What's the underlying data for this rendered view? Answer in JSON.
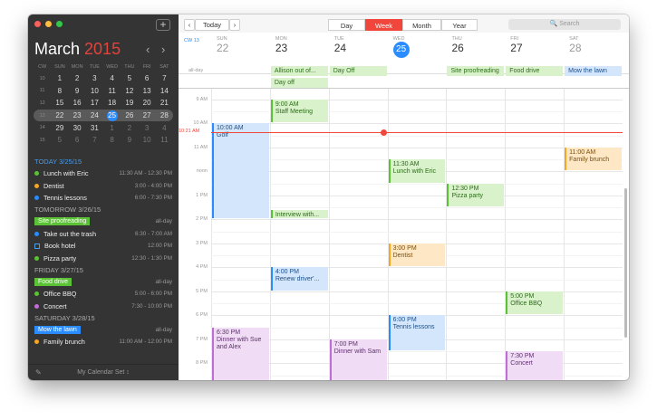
{
  "app": {
    "window": {
      "traffic": [
        "#fc605b",
        "#fdbc40",
        "#34c84a"
      ]
    },
    "add_label": "+"
  },
  "sidebar": {
    "month": "March",
    "year": "2015",
    "prev": "‹",
    "next": "›",
    "weekdays": [
      "CW",
      "SUN",
      "MON",
      "TUE",
      "WED",
      "THU",
      "FRI",
      "SAT"
    ],
    "weeks": [
      [
        "10",
        "1",
        "2",
        "3",
        "4",
        "5",
        "6",
        "7"
      ],
      [
        "11",
        "8",
        "9",
        "10",
        "11",
        "12",
        "13",
        "14"
      ],
      [
        "12",
        "15",
        "16",
        "17",
        "18",
        "19",
        "20",
        "21"
      ],
      [
        "13",
        "22",
        "23",
        "24",
        "25",
        "26",
        "27",
        "28"
      ],
      [
        "14",
        "29",
        "30",
        "31",
        "1",
        "2",
        "3",
        "4"
      ],
      [
        "15",
        "5",
        "6",
        "7",
        "8",
        "9",
        "10",
        "11"
      ]
    ],
    "agenda": [
      {
        "head": "TODAY 3/25/15",
        "today": true,
        "items": [
          {
            "label": "Lunch with Eric",
            "time": "11:30 AM - 12:30 PM",
            "color": "#5bc236"
          },
          {
            "label": "Dentist",
            "time": "3:00 - 4:00 PM",
            "color": "#f5a623"
          },
          {
            "label": "Tennis lessons",
            "time": "6:00 - 7:30 PM",
            "color": "#2b8cff"
          }
        ]
      },
      {
        "head": "TOMORROW 3/26/15",
        "today": false,
        "items": [
          {
            "label": "Site proofreading",
            "time": "all-day",
            "color": "#5bc236",
            "allday": true
          },
          {
            "label": "Take out the trash",
            "time": "6:30 - 7:00 AM",
            "color": "#2b8cff"
          },
          {
            "label": "Book hotel",
            "time": "12:00 PM",
            "color": "#2b8cff",
            "task": true
          },
          {
            "label": "Pizza party",
            "time": "12:30 - 1:30 PM",
            "color": "#5bc236"
          }
        ]
      },
      {
        "head": "FRIDAY 3/27/15",
        "today": false,
        "items": [
          {
            "label": "Food drive",
            "time": "all-day",
            "color": "#5bc236",
            "allday": true
          },
          {
            "label": "Office BBQ",
            "time": "5:00 - 6:00 PM",
            "color": "#5bc236"
          },
          {
            "label": "Concert",
            "time": "7:30 - 10:00 PM",
            "color": "#c06ed6"
          }
        ]
      },
      {
        "head": "SATURDAY 3/28/15",
        "today": false,
        "items": [
          {
            "label": "Mow the lawn",
            "time": "all-day",
            "color": "#2b8cff",
            "allday": true
          },
          {
            "label": "Family brunch",
            "time": "11:00 AM - 12:00 PM",
            "color": "#f5a623"
          }
        ]
      }
    ],
    "footer": "My Calendar Set ↕",
    "edit_icon": "✎"
  },
  "toolbar": {
    "prev": "‹",
    "today": "Today",
    "next": "›",
    "views": [
      "Day",
      "Week",
      "Month",
      "Year"
    ],
    "selected_view": "Week",
    "search_placeholder": "🔍 Search"
  },
  "week": {
    "cw": "CW 13",
    "days": [
      {
        "wd": "SUN",
        "num": "22"
      },
      {
        "wd": "MON",
        "num": "23"
      },
      {
        "wd": "TUE",
        "num": "24"
      },
      {
        "wd": "WED",
        "num": "25"
      },
      {
        "wd": "THU",
        "num": "26"
      },
      {
        "wd": "FRI",
        "num": "27"
      },
      {
        "wd": "SAT",
        "num": "28"
      }
    ],
    "allday_label": "all-day",
    "allday_events": [
      {
        "day": 1,
        "row": 0,
        "label": "Allison out of...",
        "color": "#5bc236"
      },
      {
        "day": 1,
        "row": 1,
        "label": "Day off",
        "color": "#5bc236"
      },
      {
        "day": 2,
        "row": 0,
        "label": "Day Off",
        "color": "#5bc236"
      },
      {
        "day": 4,
        "row": 0,
        "label": "Site proofreading",
        "color": "#5bc236"
      },
      {
        "day": 5,
        "row": 0,
        "label": "Food drive",
        "color": "#5bc236"
      },
      {
        "day": 6,
        "row": 0,
        "label": "Mow the lawn",
        "color": "#2b8cff"
      }
    ],
    "hours": [
      "9 AM",
      "10 AM",
      "11 AM",
      "noon",
      "1 PM",
      "2 PM",
      "3 PM",
      "4 PM",
      "5 PM",
      "6 PM",
      "7 PM",
      "8 PM"
    ],
    "now_label": "10:21 AM",
    "events": [
      {
        "day": 1,
        "start": 9.0,
        "end": 10.0,
        "title": "9:00 AM\nStaff Meeting",
        "color": "green"
      },
      {
        "day": 0,
        "start": 10.0,
        "end": 14.0,
        "title": "10:00 AM\nGolf",
        "color": "blue"
      },
      {
        "day": 1,
        "start": 13.6,
        "end": 14.0,
        "title": "Interview with...",
        "color": "green"
      },
      {
        "day": 3,
        "start": 11.5,
        "end": 12.5,
        "title": "11:30 AM\nLunch with Eric",
        "color": "green"
      },
      {
        "day": 4,
        "start": 12.5,
        "end": 13.5,
        "title": "12:30 PM\nPizza party",
        "color": "green"
      },
      {
        "day": 6,
        "start": 11.0,
        "end": 12.0,
        "title": "11:00 AM\nFamily brunch",
        "color": "orange"
      },
      {
        "day": 3,
        "start": 15.0,
        "end": 16.0,
        "title": "3:00 PM\nDentist",
        "color": "orange"
      },
      {
        "day": 1,
        "start": 16.0,
        "end": 17.0,
        "title": "4:00 PM\nRenew driver'...",
        "color": "blue"
      },
      {
        "day": 5,
        "start": 17.0,
        "end": 18.0,
        "title": "5:00 PM\nOffice BBQ",
        "color": "green"
      },
      {
        "day": 3,
        "start": 18.0,
        "end": 19.5,
        "title": "6:00 PM\nTennis lessons",
        "color": "blue"
      },
      {
        "day": 0,
        "start": 18.5,
        "end": 21.0,
        "title": "6:30 PM\nDinner with Sue\nand Alex",
        "color": "purple"
      },
      {
        "day": 2,
        "start": 19.0,
        "end": 21.0,
        "title": "7:00 PM\nDinner with Sam",
        "color": "purple"
      },
      {
        "day": 5,
        "start": 19.5,
        "end": 21.0,
        "title": "7:30 PM\nConcert",
        "color": "purple"
      }
    ]
  },
  "colors": {
    "green": [
      "#d9f2cc",
      "#5bc236",
      "#2f6b1a"
    ],
    "blue": [
      "#d3e6fb",
      "#2b8cff",
      "#1b4f8c"
    ],
    "orange": [
      "#fde7c4",
      "#f5a623",
      "#7a4f0e"
    ],
    "purple": [
      "#f0dcf5",
      "#c06ed6",
      "#5e2f6e"
    ],
    "accent": "#f0463c",
    "today": "#2b8cff"
  }
}
